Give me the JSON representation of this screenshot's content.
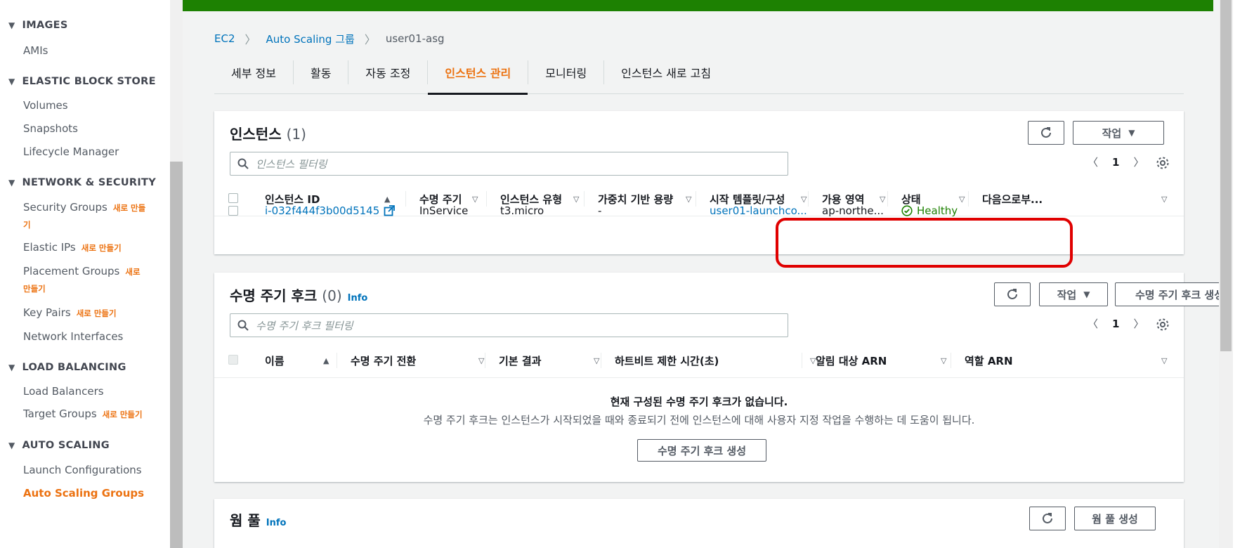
{
  "sidebar": {
    "sections": [
      {
        "title": "IMAGES",
        "items": [
          {
            "label": "AMIs",
            "new": ""
          }
        ]
      },
      {
        "title": "ELASTIC BLOCK STORE",
        "items": [
          {
            "label": "Volumes",
            "new": ""
          },
          {
            "label": "Snapshots",
            "new": ""
          },
          {
            "label": "Lifecycle Manager",
            "new": ""
          }
        ]
      },
      {
        "title": "NETWORK & SECURITY",
        "items": [
          {
            "label": "Security Groups",
            "new": "새로 만들기"
          },
          {
            "label": "Elastic IPs",
            "new": "새로 만들기"
          },
          {
            "label": "Placement Groups",
            "new": "새로 만들기"
          },
          {
            "label": "Key Pairs",
            "new": "새로 만들기"
          },
          {
            "label": "Network Interfaces",
            "new": ""
          }
        ]
      },
      {
        "title": "LOAD BALANCING",
        "items": [
          {
            "label": "Load Balancers",
            "new": ""
          },
          {
            "label": "Target Groups",
            "new": "새로 만들기"
          }
        ]
      },
      {
        "title": "AUTO SCALING",
        "items": [
          {
            "label": "Launch Configurations",
            "new": ""
          },
          {
            "label": "Auto Scaling Groups",
            "new": ""
          }
        ]
      }
    ]
  },
  "breadcrumb": {
    "root": "EC2",
    "parent": "Auto Scaling 그룹",
    "current": "user01-asg"
  },
  "tabs": [
    "세부 정보",
    "활동",
    "자동 조정",
    "인스턴스 관리",
    "모니터링",
    "인스턴스 새로 고침"
  ],
  "instances": {
    "title": "인스턴스",
    "count": "(1)",
    "action_label": "작업",
    "filter_placeholder": "인스턴스 필터링",
    "page": "1",
    "columns": [
      "인스턴스 ID",
      "수명 주기",
      "인스턴스 유형",
      "가중치 기반 용량",
      "시작 템플릿/구성",
      "가용 영역",
      "상태",
      "다음으로부..."
    ],
    "rows": [
      {
        "id": "i-032f444f3b00d5145",
        "lifecycle": "InService",
        "type": "t3.micro",
        "weight": "-",
        "template": "user01-launchco...",
        "az": "ap-northe...",
        "status": "Healthy",
        "next": ""
      }
    ]
  },
  "hooks": {
    "title": "수명 주기 후크",
    "count": "(0)",
    "info": "Info",
    "action_label": "작업",
    "create_label": "수명 주기 후크 생성",
    "filter_placeholder": "수명 주기 후크 필터링",
    "page": "1",
    "columns": [
      "이름",
      "수명 주기 전환",
      "기본 결과",
      "하트비트 제한 시간(초)",
      "알림 대상 ARN",
      "역할 ARN"
    ],
    "empty_title": "현재 구성된 수명 주기 후크가 없습니다.",
    "empty_desc": "수명 주기 후크는 인스턴스가 시작되었을 때와 종료되기 전에 인스턴스에 대해 사용자 지정 작업을 수행하는 데 도움이 됩니다.",
    "empty_button": "수명 주기 후크 생성"
  },
  "warm_pool": {
    "title": "웜 풀",
    "info": "Info",
    "create_label": "웜 풀 생성"
  },
  "colors": {
    "accent": "#ec7211",
    "link": "#0073bb",
    "success": "#1d8102",
    "highlight": "#e00000"
  }
}
